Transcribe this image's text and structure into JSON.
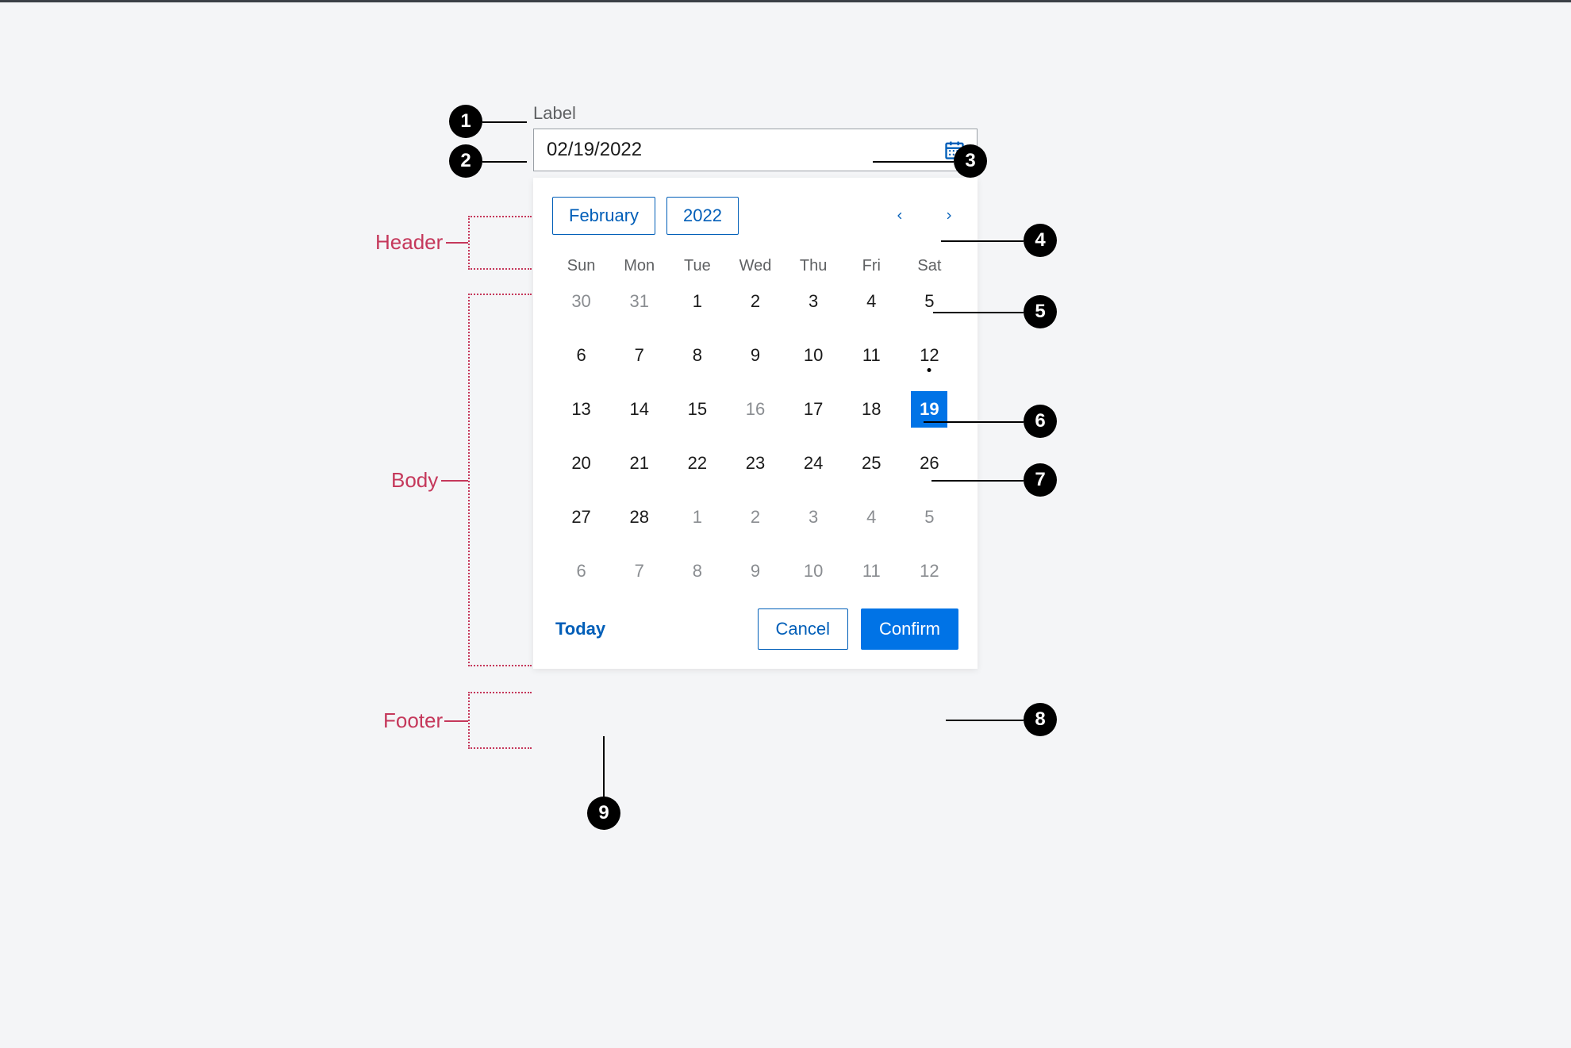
{
  "annotations": {
    "badges": {
      "1": "1",
      "2": "2",
      "3": "3",
      "4": "4",
      "5": "5",
      "6": "6",
      "7": "7",
      "8": "8",
      "9": "9"
    },
    "regions": {
      "header": "Header",
      "body": "Body",
      "footer": "Footer"
    }
  },
  "field": {
    "label": "Label",
    "value": "02/19/2022"
  },
  "header": {
    "month": "February",
    "year": "2022"
  },
  "weekdays": [
    "Sun",
    "Mon",
    "Tue",
    "Wed",
    "Thu",
    "Fri",
    "Sat"
  ],
  "days": [
    {
      "n": "30",
      "out": true
    },
    {
      "n": "31",
      "out": true
    },
    {
      "n": "1"
    },
    {
      "n": "2"
    },
    {
      "n": "3"
    },
    {
      "n": "4"
    },
    {
      "n": "5"
    },
    {
      "n": "6"
    },
    {
      "n": "7"
    },
    {
      "n": "8"
    },
    {
      "n": "9"
    },
    {
      "n": "10"
    },
    {
      "n": "11"
    },
    {
      "n": "12",
      "today": true
    },
    {
      "n": "13"
    },
    {
      "n": "14"
    },
    {
      "n": "15"
    },
    {
      "n": "16",
      "out": true
    },
    {
      "n": "17"
    },
    {
      "n": "18"
    },
    {
      "n": "19",
      "sel": true
    },
    {
      "n": "20"
    },
    {
      "n": "21"
    },
    {
      "n": "22"
    },
    {
      "n": "23"
    },
    {
      "n": "24"
    },
    {
      "n": "25"
    },
    {
      "n": "26"
    },
    {
      "n": "27"
    },
    {
      "n": "28"
    },
    {
      "n": "1",
      "out": true
    },
    {
      "n": "2",
      "out": true
    },
    {
      "n": "3",
      "out": true
    },
    {
      "n": "4",
      "out": true
    },
    {
      "n": "5",
      "out": true
    },
    {
      "n": "6",
      "out": true
    },
    {
      "n": "7",
      "out": true
    },
    {
      "n": "8",
      "out": true
    },
    {
      "n": "9",
      "out": true
    },
    {
      "n": "10",
      "out": true
    },
    {
      "n": "11",
      "out": true
    },
    {
      "n": "12",
      "out": true
    }
  ],
  "footer": {
    "today": "Today",
    "cancel": "Cancel",
    "confirm": "Confirm"
  }
}
